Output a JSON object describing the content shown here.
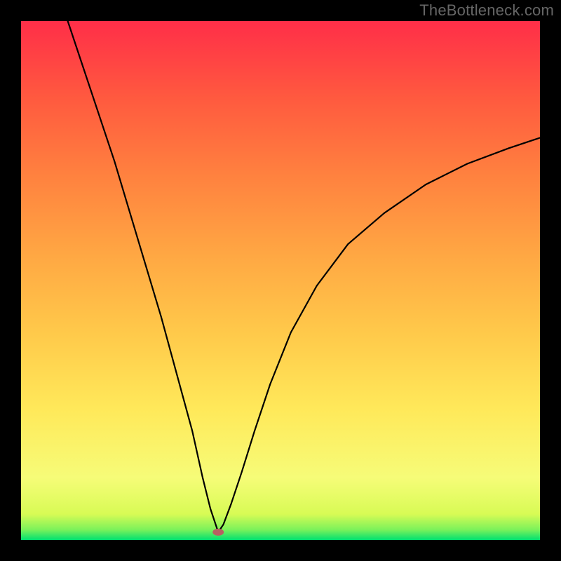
{
  "watermark": "TheBottleneck.com",
  "chart_data": {
    "type": "line",
    "title": "",
    "xlabel": "",
    "ylabel": "",
    "xlim": [
      0,
      100
    ],
    "ylim": [
      0,
      100
    ],
    "grid": false,
    "legend": false,
    "marker": {
      "x": 38,
      "y": 1.5
    },
    "series": [
      {
        "name": "left-branch",
        "x": [
          9,
          12,
          15,
          18,
          21,
          24,
          27,
          30,
          33,
          35,
          36.5,
          37.5,
          38
        ],
        "values": [
          100,
          91,
          82,
          73,
          63,
          53,
          43,
          32,
          21,
          12,
          6,
          3,
          1.5
        ]
      },
      {
        "name": "right-branch",
        "x": [
          38,
          39,
          40.5,
          42.5,
          45,
          48,
          52,
          57,
          63,
          70,
          78,
          86,
          94,
          100
        ],
        "values": [
          1.5,
          3,
          7,
          13,
          21,
          30,
          40,
          49,
          57,
          63,
          68.5,
          72.5,
          75.5,
          77.5
        ]
      }
    ],
    "background_gradient": {
      "direction": "bottom-to-top",
      "stops": [
        {
          "pos": 0,
          "color": "#00e070"
        },
        {
          "pos": 2,
          "color": "#7cf25a"
        },
        {
          "pos": 5,
          "color": "#d8fb55"
        },
        {
          "pos": 12,
          "color": "#f6fc78"
        },
        {
          "pos": 25,
          "color": "#ffe95a"
        },
        {
          "pos": 40,
          "color": "#ffc94a"
        },
        {
          "pos": 55,
          "color": "#ffa743"
        },
        {
          "pos": 70,
          "color": "#ff823f"
        },
        {
          "pos": 85,
          "color": "#ff5a3f"
        },
        {
          "pos": 100,
          "color": "#ff2e48"
        }
      ]
    }
  }
}
